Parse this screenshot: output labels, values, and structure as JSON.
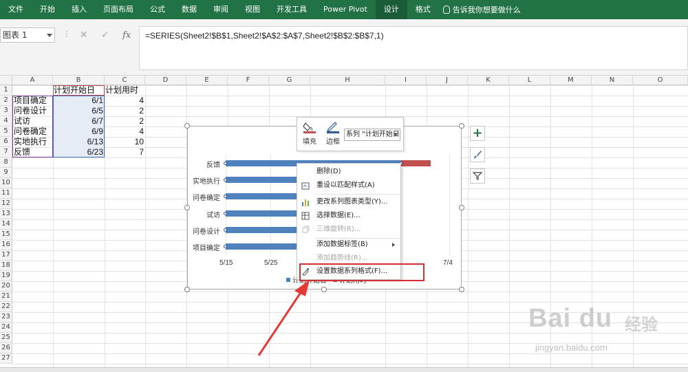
{
  "ribbon": {
    "tabs": [
      "文件",
      "开始",
      "插入",
      "页面布局",
      "公式",
      "数据",
      "审阅",
      "视图",
      "开发工具",
      "Power Pivot",
      "设计",
      "格式"
    ],
    "tell_me": "告诉我你想要做什么"
  },
  "formula_bar": {
    "name_box": "图表 1",
    "formula": "=SERIES(Sheet2!$B$1,Sheet2!$A$2:$A$7,Sheet2!$B$2:$B$7,1)",
    "fx": "fx"
  },
  "grid": {
    "columns": [
      "A",
      "B",
      "C",
      "D",
      "E",
      "F",
      "G",
      "H",
      "I",
      "J",
      "K",
      "L",
      "M",
      "N",
      "O"
    ],
    "rows": [
      "1",
      "2",
      "3",
      "4",
      "5",
      "6",
      "7",
      "8",
      "9",
      "10",
      "11",
      "12",
      "13",
      "14",
      "15",
      "16",
      "17",
      "18",
      "19",
      "20",
      "21",
      "22",
      "23",
      "24",
      "25",
      "26",
      "27"
    ],
    "header": {
      "b": "计划开始日",
      "c": "计划用时"
    },
    "data": [
      {
        "a": "项目确定",
        "b": "6/1",
        "c": "4"
      },
      {
        "a": "问卷设计",
        "b": "6/5",
        "c": "2"
      },
      {
        "a": "试访",
        "b": "6/7",
        "c": "2"
      },
      {
        "a": "问卷确定",
        "b": "6/9",
        "c": "4"
      },
      {
        "a": "实地执行",
        "b": "6/13",
        "c": "10"
      },
      {
        "a": "反馈",
        "b": "6/23",
        "c": "7"
      }
    ]
  },
  "chart_data": {
    "type": "bar",
    "categories": [
      "项目确定",
      "问卷设计",
      "问卷确定",
      "试访",
      "实地执行",
      "反馈"
    ],
    "series": [
      {
        "name": "计划开始日",
        "values": [
          "6/1",
          "6/5",
          "6/9",
          "6/7",
          "6/13",
          "6/23"
        ],
        "color": "#4f81bd"
      },
      {
        "name": "计划用时",
        "values": [
          4,
          2,
          4,
          2,
          10,
          7
        ],
        "color": "#c0504d"
      }
    ],
    "x_ticks": [
      "5/15",
      "5/25",
      "7/4"
    ],
    "orientation": "horizontal",
    "stacked": true,
    "legend_position": "bottom"
  },
  "mini_toolbar": {
    "fill_label": "填充",
    "outline_label": "边框",
    "series_select": "系列 \"计划开始日\""
  },
  "context_menu": {
    "items": [
      {
        "label": "删除(D)",
        "enabled": true
      },
      {
        "label": "重设以匹配样式(A)",
        "enabled": true
      },
      {
        "label": "更改系列图表类型(Y)...",
        "enabled": true
      },
      {
        "label": "选择数据(E)...",
        "enabled": true
      },
      {
        "label": "三维旋转(R)...",
        "enabled": false
      },
      {
        "label": "添加数据标签(B)",
        "enabled": true
      },
      {
        "label": "添加趋势线(R)...",
        "enabled": false
      },
      {
        "label": "设置数据系列格式(F)...",
        "enabled": true
      }
    ]
  },
  "watermark": {
    "brand": "Bai du",
    "brand_zh": "经验",
    "url": "jingyan.baidu.com"
  },
  "colors": {
    "ribbon": "#217346",
    "series1": "#4f81bd",
    "series2": "#c0504d",
    "highlight": "#d32f2f"
  }
}
